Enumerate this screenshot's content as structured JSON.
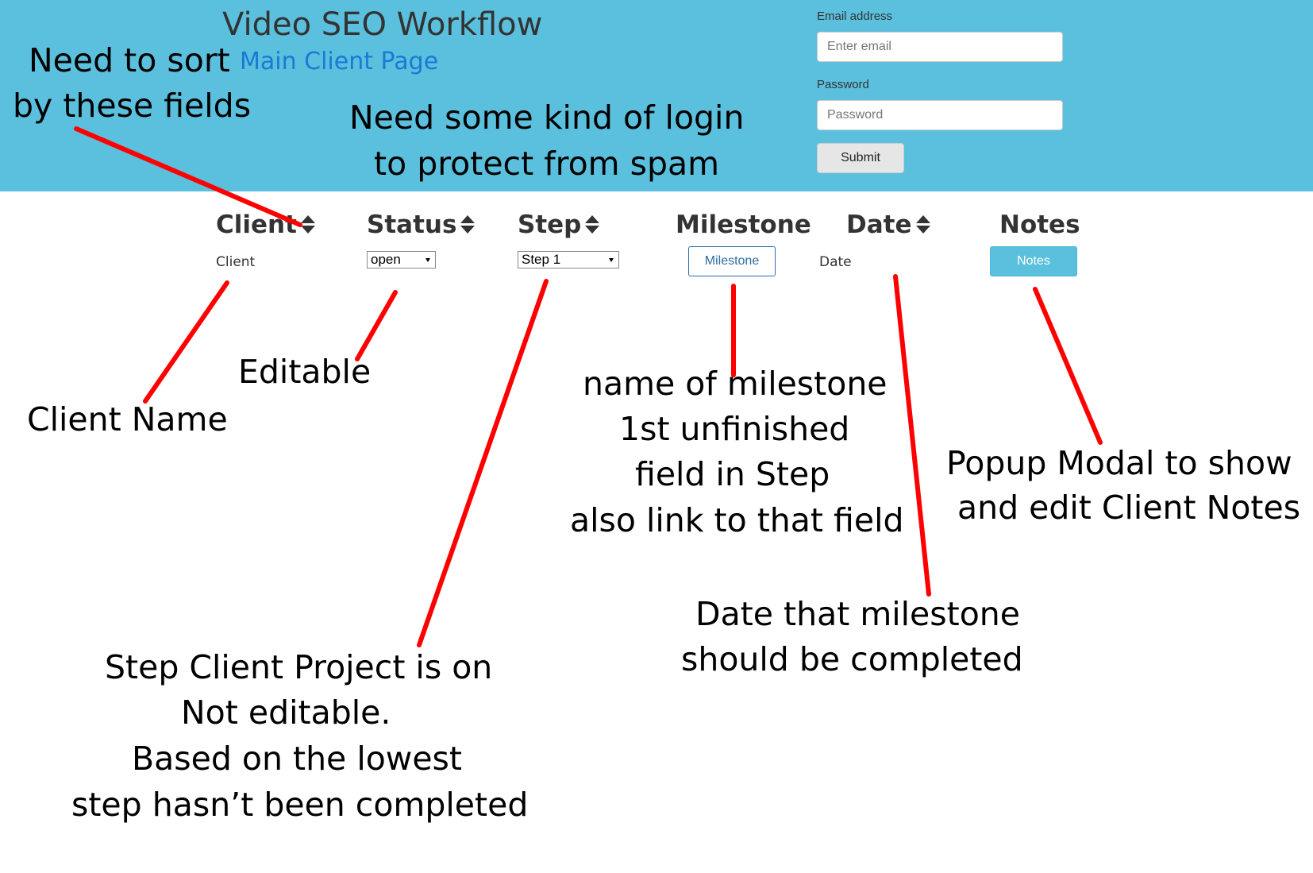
{
  "header": {
    "app_title": "Video SEO Workflow",
    "main_link": "Main Client Page",
    "email_label": "Email address",
    "email_placeholder": "Enter email",
    "password_label": "Password",
    "password_placeholder": "Password",
    "submit_label": "Submit",
    "bg_color": "#5bc0de"
  },
  "table": {
    "headers": {
      "client": "Client",
      "status": "Status",
      "step": "Step",
      "milestone": "Milestone",
      "date": "Date",
      "notes": "Notes"
    },
    "row": {
      "client": "Client",
      "status": "open",
      "step": "Step 1",
      "milestone": "Milestone",
      "date": "Date",
      "notes": "Notes"
    }
  },
  "annotations": {
    "sort_1": "Need to sort",
    "sort_2": "by these fields",
    "login_1": "Need some kind of login",
    "login_2": "to protect from spam",
    "editable": "Editable",
    "client_name": "Client Name",
    "milestone_1": "name of milestone",
    "milestone_2": "1st unfinished",
    "milestone_3": "field in Step",
    "milestone_4": "also link to that field",
    "notes_1": "Popup Modal to show",
    "notes_2": "and edit Client Notes",
    "date_1": "Date that milestone",
    "date_2": "should be completed",
    "step_1": "Step Client Project is on",
    "step_2": "Not editable.",
    "step_3": "Based on the lowest",
    "step_4": "step hasn’t been completed"
  },
  "annotation_line_color": "#ff0000"
}
